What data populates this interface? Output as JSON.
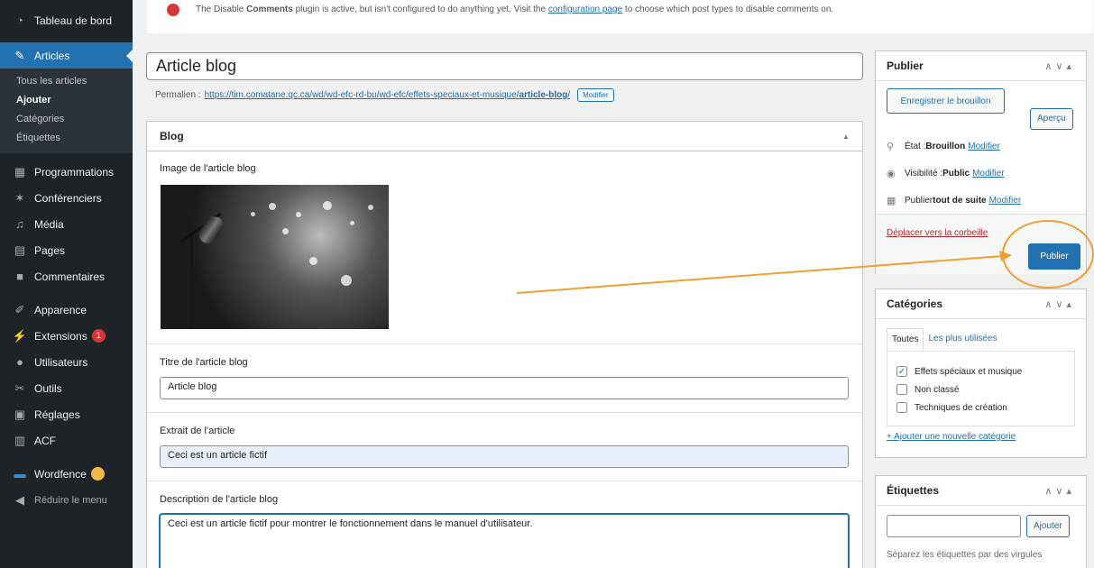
{
  "sidebar": {
    "dashboard": "Tableau de bord",
    "articles": "Articles",
    "submenu": [
      "Tous les articles",
      "Ajouter",
      "Catégories",
      "Étiquettes"
    ],
    "items": [
      {
        "label": "Programmations",
        "icon": "calendar-icon"
      },
      {
        "label": "Conférenciers",
        "icon": "star-icon"
      },
      {
        "label": "Média",
        "icon": "media-icon"
      },
      {
        "label": "Pages",
        "icon": "pages-icon"
      },
      {
        "label": "Commentaires",
        "icon": "comments-icon"
      },
      {
        "label": "Apparence",
        "icon": "brush-icon"
      },
      {
        "label": "Extensions",
        "icon": "plugin-icon",
        "badge": "1"
      },
      {
        "label": "Utilisateurs",
        "icon": "users-icon"
      },
      {
        "label": "Outils",
        "icon": "wrench-icon"
      },
      {
        "label": "Réglages",
        "icon": "settings-icon"
      },
      {
        "label": "ACF",
        "icon": "acf-icon"
      },
      {
        "label": "Wordfence",
        "icon": "wordfence-icon",
        "badge": ""
      }
    ],
    "collapse": "Réduire le menu"
  },
  "notice": {
    "text_before": "The Disable ",
    "bold": "Comments",
    "text_middle": " plugin is active, but isn't configured to do anything yet. Visit the ",
    "link": "configuration page",
    "text_after": " to choose which post types to disable comments on."
  },
  "post": {
    "title": "Article blog",
    "permalink_label": "Permalien :",
    "permalink_url_base": "https://tim.comatane.qc.ca/wd/wd-efc-rd-bu/wd-efc/effets-speciaux-et-musique/",
    "permalink_slug": "article-blog",
    "permalink_edit": "Modifier"
  },
  "blog_box": {
    "title": "Blog",
    "image_label": "Image de l'article blog",
    "title_label": "Titre de l'article blog",
    "title_value": "Article blog",
    "excerpt_label": "Extrait de l'article",
    "excerpt_value": "Ceci est un article fictif",
    "description_label": "Description de l'article blog",
    "description_value": "Ceci est un article fictif pour montrer le fonctionnement dans le manuel d'utilisateur."
  },
  "publish": {
    "title": "Publier",
    "save_draft": "Enregistrer le brouillon",
    "preview": "Aperçu",
    "status_label": "État : ",
    "status_value": "Brouillon",
    "visibility_label": "Visibilité : ",
    "visibility_value": "Public",
    "schedule_label": "Publier ",
    "schedule_value": "tout de suite",
    "modify": "Modifier",
    "trash": "Déplacer vers la corbeille",
    "publish_button": "Publier"
  },
  "categories": {
    "title": "Catégories",
    "tab_all": "Toutes",
    "tab_popular": "Les plus utilisées",
    "items": [
      {
        "label": "Effets spéciaux et musique",
        "checked": true
      },
      {
        "label": "Non classé",
        "checked": false
      },
      {
        "label": "Techniques de création",
        "checked": false
      }
    ],
    "add_new": "+ Ajouter une nouvelle catégorie"
  },
  "tags": {
    "title": "Étiquettes",
    "add_button": "Ajouter",
    "help": "Séparez les étiquettes par des virgules"
  },
  "colors": {
    "accent": "#2271b1",
    "annotation": "#f0a030",
    "sidebar": "#1d2327"
  }
}
